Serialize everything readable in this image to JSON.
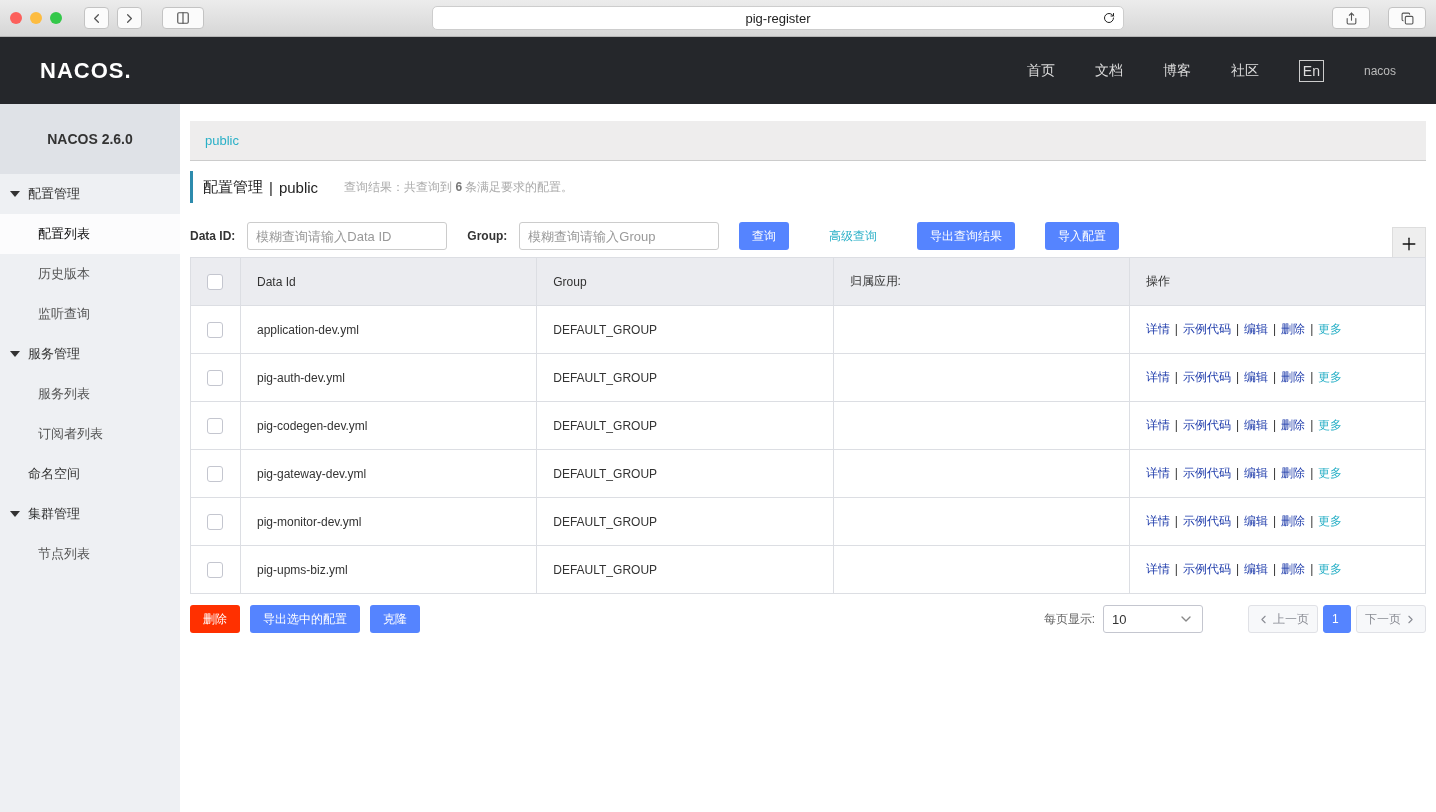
{
  "browser": {
    "url": "pig-register"
  },
  "header": {
    "logo": "NACOS.",
    "nav": [
      "首页",
      "文档",
      "博客",
      "社区"
    ],
    "language": "En",
    "user": "nacos"
  },
  "sidebar": {
    "title": "NACOS 2.6.0",
    "items": [
      {
        "label": "配置管理",
        "expanded": true,
        "selected": false,
        "children": [
          {
            "label": "配置列表",
            "selected": true
          },
          {
            "label": "历史版本",
            "selected": false
          },
          {
            "label": "监听查询",
            "selected": false
          }
        ]
      },
      {
        "label": "服务管理",
        "expanded": true,
        "selected": false,
        "children": [
          {
            "label": "服务列表",
            "selected": false
          },
          {
            "label": "订阅者列表",
            "selected": false
          }
        ]
      },
      {
        "label": "命名空间",
        "selected": false
      },
      {
        "label": "集群管理",
        "expanded": true,
        "selected": false,
        "children": [
          {
            "label": "节点列表",
            "selected": false
          }
        ]
      }
    ]
  },
  "namespace_bar": {
    "namespace": "public"
  },
  "page_title": {
    "title": "配置管理",
    "separator": "|",
    "namespace": "public",
    "summary": "查询结果：共查询到 **6** 条满足要求的配置。"
  },
  "search": {
    "data_id_label": "Data ID:",
    "data_id_placeholder": "模糊查询请输入Data ID",
    "group_label": "Group:",
    "group_placeholder": "模糊查询请输入Group",
    "buttons": [
      {
        "label": "查询",
        "kind": "primary"
      },
      {
        "label": "高级查询",
        "kind": "link"
      },
      {
        "label": "导出查询结果",
        "kind": "primary"
      },
      {
        "label": "导入配置",
        "kind": "primary"
      }
    ]
  },
  "table": {
    "columns": [
      "Data Id",
      "Group",
      "归属应用:",
      "操作"
    ],
    "all_checked": false,
    "rows": [
      {
        "data_id": "application-dev.yml",
        "group": "DEFAULT_GROUP",
        "checked": false,
        "actions": [
          {
            "label": "详情",
            "kind": "link"
          },
          {
            "label": "示例代码",
            "kind": "link"
          },
          {
            "label": "编辑",
            "kind": "link"
          },
          {
            "label": "删除",
            "kind": "link"
          },
          {
            "label": "更多",
            "kind": "more"
          }
        ],
        "separators": [
          "|",
          "|",
          "|",
          "|"
        ]
      },
      {
        "data_id": "pig-auth-dev.yml",
        "group": "DEFAULT_GROUP",
        "checked": false,
        "actions": [
          {
            "label": "详情",
            "kind": "link"
          },
          {
            "label": "示例代码",
            "kind": "link"
          },
          {
            "label": "编辑",
            "kind": "link"
          },
          {
            "label": "删除",
            "kind": "link"
          },
          {
            "label": "更多",
            "kind": "more"
          }
        ],
        "separators": [
          "|",
          "|",
          "|",
          "|"
        ]
      },
      {
        "data_id": "pig-codegen-dev.yml",
        "group": "DEFAULT_GROUP",
        "checked": false,
        "actions": [
          {
            "label": "详情",
            "kind": "link"
          },
          {
            "label": "示例代码",
            "kind": "link"
          },
          {
            "label": "编辑",
            "kind": "link"
          },
          {
            "label": "删除",
            "kind": "link"
          },
          {
            "label": "更多",
            "kind": "more"
          }
        ],
        "separators": [
          "|",
          "|",
          "|",
          "|"
        ]
      },
      {
        "data_id": "pig-gateway-dev.yml",
        "group": "DEFAULT_GROUP",
        "checked": false,
        "actions": [
          {
            "label": "详情",
            "kind": "link"
          },
          {
            "label": "示例代码",
            "kind": "link"
          },
          {
            "label": "编辑",
            "kind": "link"
          },
          {
            "label": "删除",
            "kind": "link"
          },
          {
            "label": "更多",
            "kind": "more"
          }
        ],
        "separators": [
          "|",
          "|",
          "|",
          "|"
        ]
      },
      {
        "data_id": "pig-monitor-dev.yml",
        "group": "DEFAULT_GROUP",
        "checked": false,
        "actions": [
          {
            "label": "详情",
            "kind": "link"
          },
          {
            "label": "示例代码",
            "kind": "link"
          },
          {
            "label": "编辑",
            "kind": "link"
          },
          {
            "label": "删除",
            "kind": "link"
          },
          {
            "label": "更多",
            "kind": "more"
          }
        ],
        "separators": [
          "|",
          "|",
          "|",
          "|"
        ]
      },
      {
        "data_id": "pig-upms-biz.yml",
        "group": "DEFAULT_GROUP",
        "checked": false,
        "actions": [
          {
            "label": "详情",
            "kind": "link"
          },
          {
            "label": "示例代码",
            "kind": "link"
          },
          {
            "label": "编辑",
            "kind": "link"
          },
          {
            "label": "删除",
            "kind": "link"
          },
          {
            "label": "更多",
            "kind": "more"
          }
        ],
        "separators": [
          "|",
          "|",
          "|",
          "|"
        ]
      }
    ]
  },
  "footer": {
    "buttons": [
      {
        "label": "删除",
        "kind": "danger"
      },
      {
        "label": "导出选中的配置",
        "kind": "primary"
      },
      {
        "label": "克隆",
        "kind": "primary"
      }
    ],
    "page_size_label": "每页显示:",
    "page_size": "10",
    "pager": [
      {
        "label": "上一页",
        "kind": "prev",
        "disabled": true,
        "selected": false
      },
      {
        "label": "1",
        "kind": "page",
        "disabled": false,
        "selected": true
      },
      {
        "label": "下一页",
        "kind": "next",
        "disabled": true,
        "selected": false
      }
    ]
  }
}
